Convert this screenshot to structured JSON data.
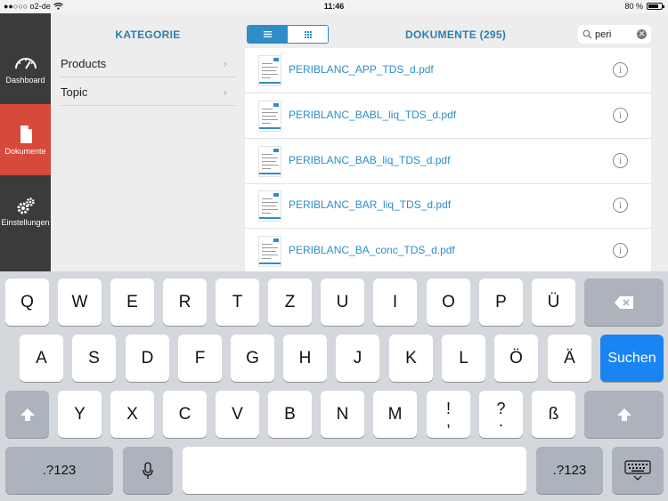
{
  "status_bar": {
    "carrier": "●●○○○ o2-de",
    "time": "11:46",
    "battery": "80 %",
    "battery_level": 0.8
  },
  "sidebar": {
    "items": [
      {
        "label": "Dashboard",
        "icon": "gauge-icon",
        "active": false
      },
      {
        "label": "Dokumente",
        "icon": "document-icon",
        "active": true
      },
      {
        "label": "Einstellungen",
        "icon": "gears-icon",
        "active": false
      }
    ]
  },
  "categories": {
    "title": "KATEGORIE",
    "items": [
      {
        "label": "Products"
      },
      {
        "label": "Topic"
      }
    ]
  },
  "documents": {
    "title": "DOKUMENTE (295)",
    "view_toggle": {
      "options": [
        "list-icon",
        "grid-icon"
      ],
      "selected": "list-icon"
    },
    "search": {
      "value": "peri"
    },
    "items": [
      {
        "name": "PERIBLANC_APP_TDS_d.pdf"
      },
      {
        "name": "PERIBLANC_BABL_liq_TDS_d.pdf"
      },
      {
        "name": "PERIBLANC_BAB_liq_TDS_d.pdf"
      },
      {
        "name": "PERIBLANC_BAR_liq_TDS_d.pdf"
      },
      {
        "name": "PERIBLANC_BA_conc_TDS_d.pdf"
      }
    ]
  },
  "keyboard": {
    "row1": [
      "Q",
      "W",
      "E",
      "R",
      "T",
      "Z",
      "U",
      "I",
      "O",
      "P",
      "Ü"
    ],
    "row2": [
      "A",
      "S",
      "D",
      "F",
      "G",
      "H",
      "J",
      "K",
      "L",
      "Ö",
      "Ä"
    ],
    "row3": [
      "Y",
      "X",
      "C",
      "V",
      "B",
      "N",
      "M"
    ],
    "punct1": {
      "top": "!",
      "bottom": ","
    },
    "punct2": {
      "top": "?",
      "bottom": "."
    },
    "sz": "ß",
    "return_label": "Suchen",
    "numbers_label": ".?123"
  },
  "colors": {
    "accent": "#2e8dc7",
    "active_nav": "#d6493b",
    "sidebar": "#3b3b3b",
    "return_key": "#1a84f2"
  }
}
